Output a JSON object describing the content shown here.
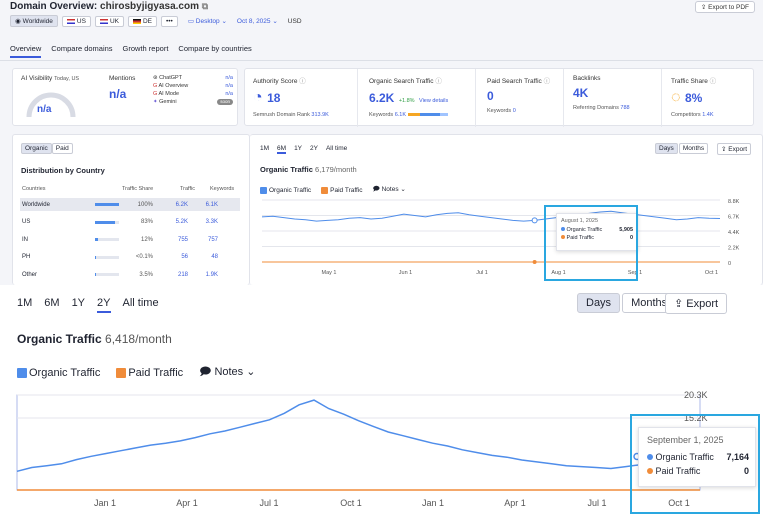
{
  "header": {
    "title": "Domain Overview:",
    "domain": "chirosbyjigyasa.com",
    "export_pdf": "Export to PDF"
  },
  "filters": {
    "worldwide": "Worldwide",
    "us": "US",
    "uk": "UK",
    "de": "DE",
    "more": "•••",
    "device": "Desktop",
    "date": "Oct 8, 2025",
    "currency": "USD"
  },
  "nav_tabs": [
    "Overview",
    "Compare domains",
    "Growth report",
    "Compare by countries"
  ],
  "ai": {
    "label": "AI Visibility",
    "sublabel": "Today, US",
    "value": "n/a",
    "mentions_label": "Mentions",
    "mentions_value": "n/a",
    "llms": [
      {
        "name": "ChatGPT",
        "value": "n/a"
      },
      {
        "name": "AI Overview",
        "value": "n/a"
      },
      {
        "name": "AI Mode",
        "value": "n/a"
      },
      {
        "name": "Gemini",
        "value": "soon"
      }
    ]
  },
  "kpis": {
    "authority": {
      "label": "Authority Score",
      "value": "18",
      "sub_label": "Semrush Domain Rank",
      "sub_value": "313.9K"
    },
    "organic": {
      "label": "Organic Search Traffic",
      "value": "6.2K",
      "change": "+1.8%",
      "details": "View details",
      "sub_label": "Keywords",
      "sub_value": "6.1K"
    },
    "paid": {
      "label": "Paid Search Traffic",
      "value": "0",
      "sub_label": "Keywords",
      "sub_value": "0"
    },
    "backlinks": {
      "label": "Backlinks",
      "value": "4K",
      "sub_label": "Referring Domains",
      "sub_value": "788"
    },
    "share": {
      "label": "Traffic Share",
      "value": "8%",
      "sub_label": "Competitors",
      "sub_value": "1.4K"
    }
  },
  "distribution": {
    "toggle": [
      "Organic",
      "Paid"
    ],
    "title": "Distribution by Country",
    "headers": [
      "Countries",
      "Traffic Share",
      "Traffic",
      "Keywords"
    ],
    "rows": [
      {
        "country": "Worldwide",
        "share": "100%",
        "share_frac": 1.0,
        "traffic": "6.2K",
        "keywords": "6.1K"
      },
      {
        "country": "US",
        "share": "83%",
        "share_frac": 0.83,
        "traffic": "5.2K",
        "keywords": "3.3K"
      },
      {
        "country": "IN",
        "share": "12%",
        "share_frac": 0.12,
        "traffic": "755",
        "keywords": "757"
      },
      {
        "country": "PH",
        "share": "<0.1%",
        "share_frac": 0.02,
        "traffic": "56",
        "keywords": "48"
      },
      {
        "country": "Other",
        "share": "3.5%",
        "share_frac": 0.035,
        "traffic": "218",
        "keywords": "1.9K"
      }
    ]
  },
  "chart_small": {
    "ranges": [
      "1M",
      "6M",
      "1Y",
      "2Y",
      "All time"
    ],
    "active_range": "6M",
    "title": "Organic Traffic",
    "title_value": "6,179/month",
    "legend_organic": "Organic Traffic",
    "legend_paid": "Paid Traffic",
    "notes": "Notes",
    "days": "Days",
    "months": "Months",
    "export": "Export",
    "tooltip": {
      "date": "August 1, 2025",
      "organic_label": "Organic Traffic",
      "organic_value": "5,905",
      "paid_label": "Paid Traffic",
      "paid_value": "0"
    }
  },
  "chart_big": {
    "ranges": [
      "1M",
      "6M",
      "1Y",
      "2Y",
      "All time"
    ],
    "active_range": "2Y",
    "title": "Organic Traffic",
    "title_value": "6,418/month",
    "legend_organic": "Organic Traffic",
    "legend_paid": "Paid Traffic",
    "notes": "Notes",
    "days": "Days",
    "months": "Months",
    "export": "Export",
    "tooltip": {
      "date": "September 1, 2025",
      "organic_label": "Organic Traffic",
      "organic_value": "7,164",
      "paid_label": "Paid Traffic",
      "paid_value": "0"
    }
  },
  "chart_data": [
    {
      "type": "line",
      "title": "Organic Traffic",
      "x_ticks": [
        "May 1",
        "Jun 1",
        "Jul 1",
        "Aug 1",
        "Sep 1",
        "Oct 1"
      ],
      "y_ticks": [
        "8.8K",
        "6.7K",
        "4.4K",
        "2.2K",
        "0"
      ],
      "ylim": [
        0,
        8800
      ],
      "series": [
        {
          "name": "Organic Traffic",
          "color": "#4f8dea",
          "values": [
            6400,
            6500,
            6300,
            6100,
            6000,
            5800,
            5900,
            6000,
            6200,
            6300,
            6100,
            6200,
            6500,
            6800,
            6600,
            6400,
            6700,
            6900,
            7000,
            6700,
            6500,
            6300,
            6100,
            5900,
            5800,
            5905,
            6100,
            6300,
            6500,
            6700,
            6900,
            7100,
            7200,
            7000,
            6800,
            6600,
            6400,
            6200,
            6000,
            6100,
            6300,
            6200,
            6179
          ]
        },
        {
          "name": "Paid Traffic",
          "color": "#f08c3a",
          "values": [
            0,
            0,
            0,
            0,
            0,
            0,
            0,
            0,
            0,
            0,
            0,
            0,
            0,
            0,
            0,
            0,
            0,
            0,
            0,
            0,
            0,
            0,
            0,
            0,
            0,
            0,
            0,
            0,
            0,
            0,
            0,
            0,
            0,
            0,
            0,
            0,
            0,
            0,
            0,
            0,
            0,
            0,
            0
          ]
        }
      ]
    },
    {
      "type": "line",
      "title": "Organic Traffic",
      "x_ticks": [
        "Jan 1",
        "Apr 1",
        "Jul 1",
        "Oct 1",
        "Jan 1",
        "Apr 1",
        "Jul 1",
        "Oct 1"
      ],
      "y_ticks": [
        "20.3K",
        "15.2K"
      ],
      "ylim": [
        0,
        20300
      ],
      "series": [
        {
          "name": "Organic Traffic",
          "color": "#4f8dea",
          "values": [
            4000,
            4800,
            5200,
            5600,
            6500,
            7200,
            7800,
            8400,
            9000,
            9600,
            10000,
            10500,
            11200,
            12000,
            12600,
            13400,
            14200,
            15000,
            16400,
            18200,
            19200,
            17400,
            16200,
            14800,
            13600,
            12400,
            11600,
            10800,
            10000,
            9400,
            8600,
            8000,
            7400,
            7000,
            6400,
            6000,
            5600,
            5200,
            5000,
            4800,
            4600,
            5000,
            5400,
            6200,
            7000,
            6600,
            7164
          ]
        },
        {
          "name": "Paid Traffic",
          "color": "#f08c3a",
          "values": [
            0,
            0,
            0,
            0,
            0,
            0,
            0,
            0,
            0,
            0,
            0,
            0,
            0,
            0,
            0,
            0,
            0,
            0,
            0,
            0,
            0,
            0,
            0,
            0,
            0,
            0,
            0,
            0,
            0,
            0,
            0,
            0,
            0,
            0,
            0,
            0,
            0,
            0,
            0,
            0,
            0,
            0,
            0,
            0,
            0,
            0,
            0
          ]
        }
      ]
    }
  ]
}
